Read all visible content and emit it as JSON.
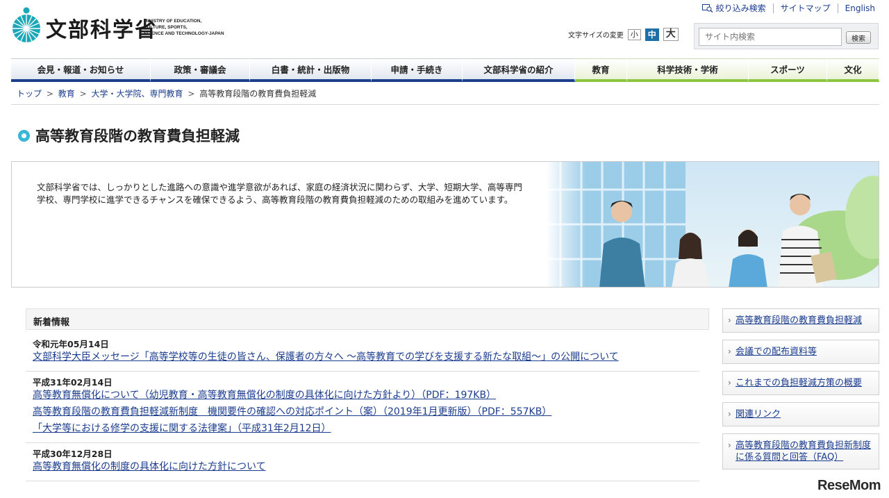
{
  "header": {
    "logo_jp": "文部科学省",
    "logo_en": [
      "MINISTRY OF EDUCATION,",
      "CULTURE, SPORTS,",
      "SCIENCE AND TECHNOLOGY-JAPAN"
    ],
    "utility_links": [
      "絞り込み検索",
      "サイトマップ",
      "English"
    ],
    "font_size_label": "文字サイズの変更",
    "font_sizes": [
      "小",
      "中",
      "大"
    ],
    "search_placeholder": "サイト内検索",
    "search_button": "検索"
  },
  "nav": {
    "items": [
      "会見・報道・お知らせ",
      "政策・審議会",
      "白書・統計・出版物",
      "申請・手続き",
      "文部科学省の紹介",
      "教育",
      "科学技術・学術",
      "スポーツ",
      "文化"
    ]
  },
  "breadcrumb": {
    "items": [
      "トップ",
      "教育",
      "大学・大学院、専門教育"
    ],
    "current": "高等教育段階の教育費負担軽減",
    "separator": ">"
  },
  "page_title": "高等教育段階の教育費負担軽減",
  "intro": {
    "text": "文部科学省では、しっかりとした進路への意識や進学意欲があれば、家庭の経済状況に関わらず、大学、短期大学、高等専門学校、専門学校に進学できるチャンスを確保できるよう、高等教育段階の教育費負担軽減のための取組みを進めています。"
  },
  "news": {
    "heading": "新着情報",
    "groups": [
      {
        "date": "令和元年05月14日",
        "links": [
          "文部科学大臣メッセージ「高等学校等の生徒の皆さん、保護者の方々へ ～高等教育での学びを支援する新たな取組～」の公開について"
        ]
      },
      {
        "date": "平成31年02月14日",
        "links": [
          "高等教育無償化について（幼児教育・高等教育無償化の制度の具体化に向けた方針より）（PDF：197KB）",
          "高等教育段階の教育費負担軽減新制度　機関要件の確認への対応ポイント（案）（2019年1月更新版）（PDF：557KB）",
          "「大学等における修学の支援に関する法律案」（平成31年2月12日）"
        ]
      },
      {
        "date": "平成30年12月28日",
        "links": [
          "高等教育無償化の制度の具体化に向けた方針について"
        ]
      }
    ]
  },
  "side_menu": {
    "items": [
      "高等教育段階の教育費負担軽減",
      "会議での配布資料等",
      "これまでの負担軽減方策の概要",
      "関連リンク",
      "高等教育段階の教育費負担新制度に係る質問と回答（FAQ）"
    ]
  },
  "watermark": {
    "text_a": "Rese",
    "text_b": "Mom"
  },
  "colors": {
    "nav_blue": "#1d3f8c",
    "nav_green": "#8cc63f",
    "link": "#1a3c8f",
    "title_dot": "#3ab6d6"
  }
}
